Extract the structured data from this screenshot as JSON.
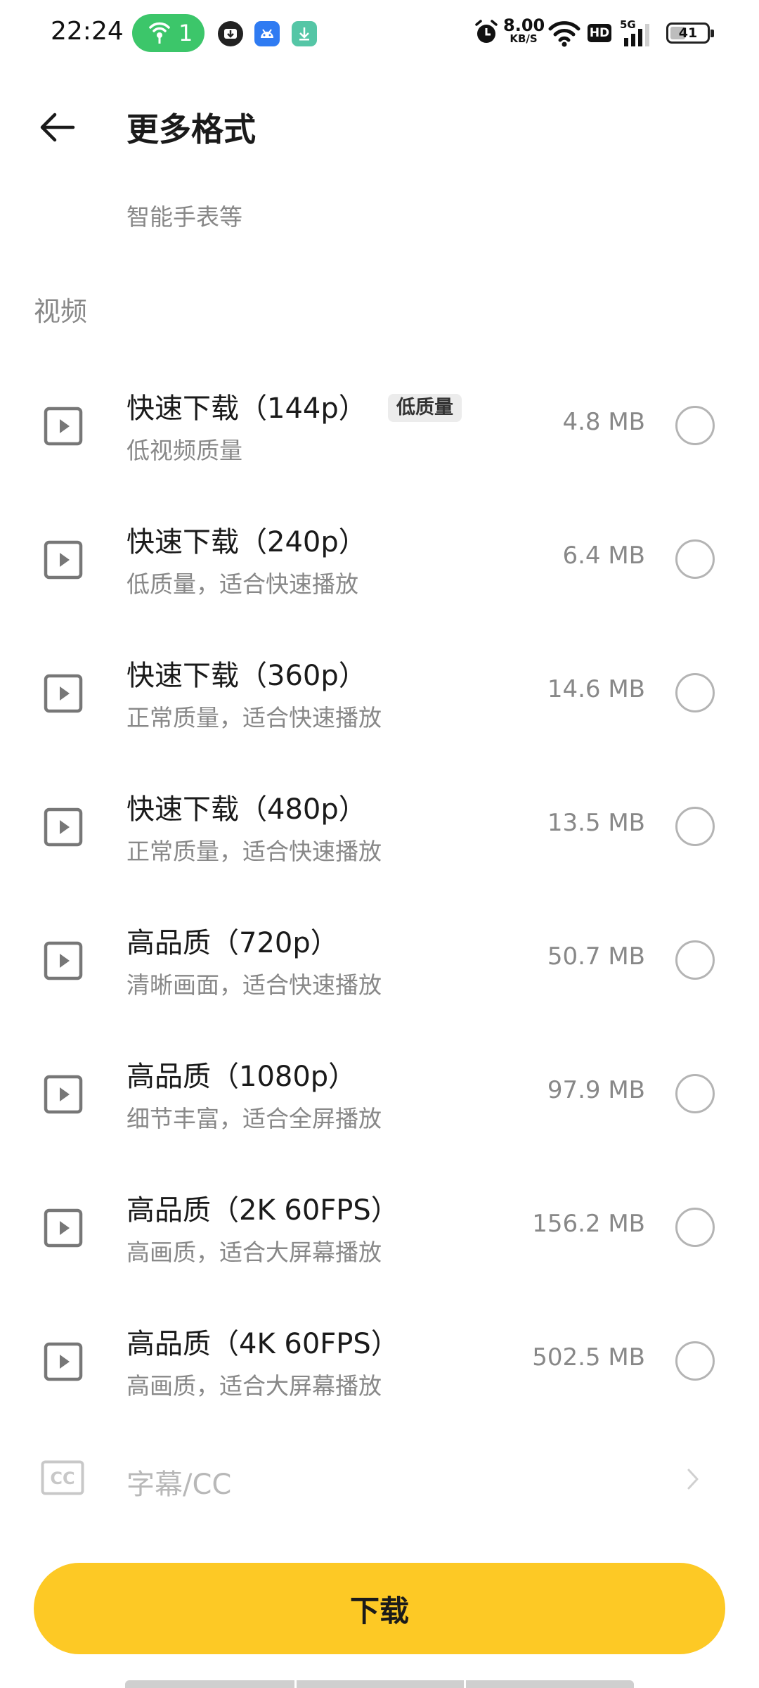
{
  "status_bar": {
    "time": "22:24",
    "hotspot_count": "1",
    "speed_value": "8.00",
    "speed_unit": "KB/S",
    "hd": "HD",
    "network": "5G",
    "battery_level": 0.41,
    "battery_label": "41",
    "hotspot_color": "#3cc66a"
  },
  "header": {
    "title": "更多格式"
  },
  "partial_description": "智能手表等",
  "section": {
    "label": "视频"
  },
  "formats": [
    {
      "title": "快速下载（144p）",
      "badge": "低质量",
      "subtitle": "低视频质量",
      "size": "4.8 MB"
    },
    {
      "title": "快速下载（240p）",
      "subtitle": "低质量，适合快速播放",
      "size": "6.4 MB"
    },
    {
      "title": "快速下载（360p）",
      "subtitle": "正常质量，适合快速播放",
      "size": "14.6 MB"
    },
    {
      "title": "快速下载（480p）",
      "subtitle": "正常质量，适合快速播放",
      "size": "13.5 MB"
    },
    {
      "title": "高品质（720p）",
      "subtitle": "清晰画面，适合快速播放",
      "size": "50.7 MB"
    },
    {
      "title": "高品质（1080p）",
      "subtitle": "细节丰富，适合全屏播放",
      "size": "97.9 MB"
    },
    {
      "title": "高品质（2K 60FPS）",
      "subtitle": "高画质，适合大屏幕播放",
      "size": "156.2 MB"
    },
    {
      "title": "高品质（4K 60FPS）",
      "subtitle": "高画质，适合大屏幕播放",
      "size": "502.5 MB"
    }
  ],
  "subtitles_row": {
    "label": "字幕/CC",
    "icon_text": "CC"
  },
  "download_button": {
    "label": "下载",
    "color": "#fdc925"
  }
}
